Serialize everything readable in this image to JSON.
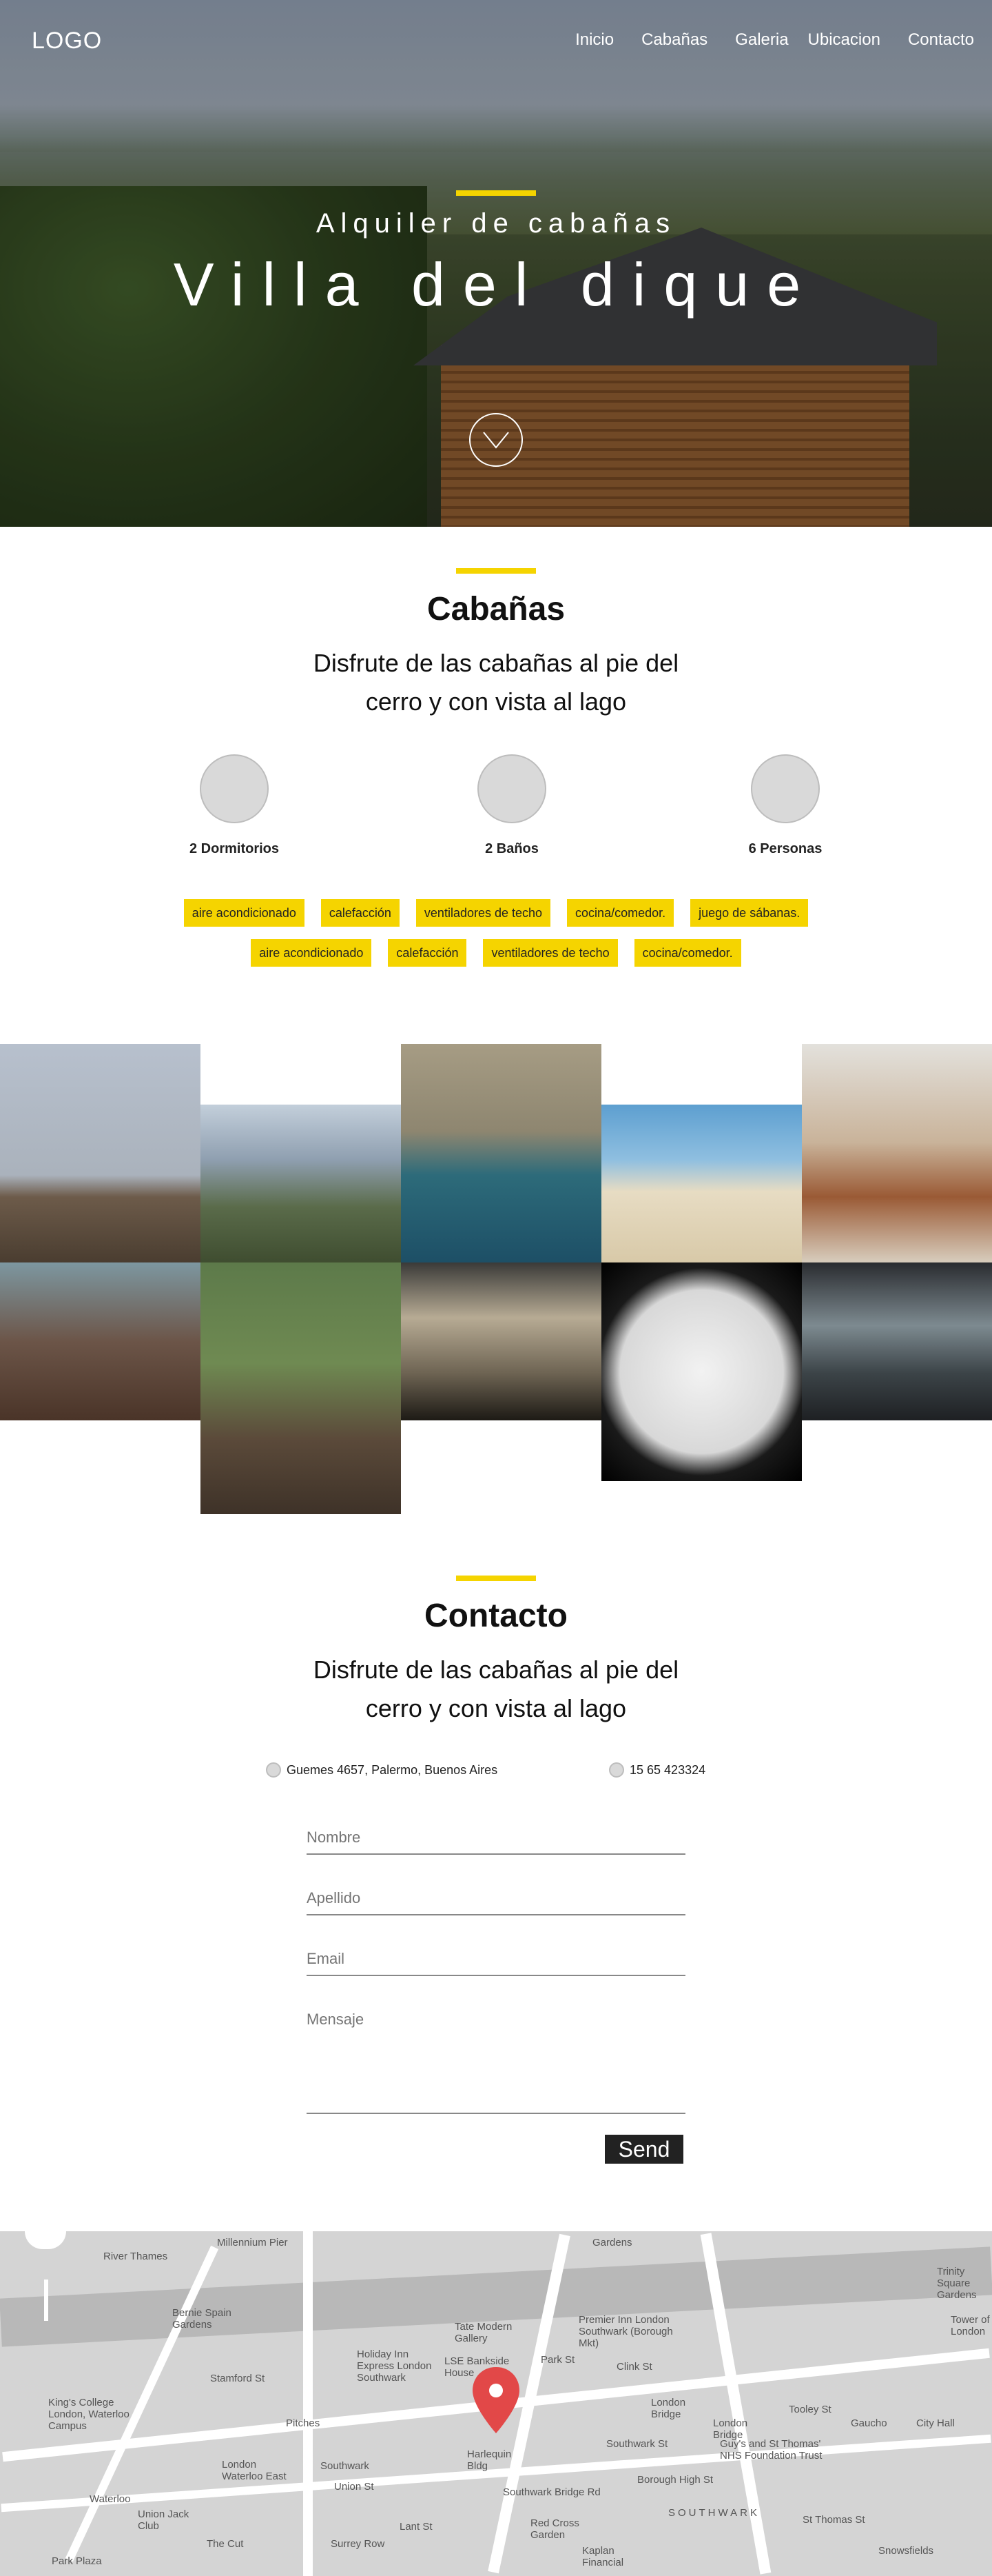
{
  "nav": {
    "logo": "LOGO",
    "links": [
      "Inicio",
      "Cabañas",
      "Galeria",
      "Ubicacion",
      "Contacto"
    ]
  },
  "hero": {
    "subtitle": "Alquiler de cabañas",
    "title": "Villa del dique"
  },
  "cabanas": {
    "title": "Cabañas",
    "description": "Disfrute de las cabañas al pie del cerro y con vista al lago",
    "features": [
      "2 Dormitorios",
      "2 Baños",
      "6 Personas"
    ],
    "tags_row1": [
      "aire acondicionado",
      "calefacción",
      "ventiladores de techo",
      "cocina/comedor.",
      "juego de sábanas."
    ],
    "tags_row2": [
      "aire acondicionado",
      "calefacción",
      "ventiladores de techo",
      "cocina/comedor."
    ]
  },
  "contacto": {
    "title": "Contacto",
    "description": "Disfrute de las cabañas al pie del cerro y con vista al lago",
    "address": "Guemes 4657, Palermo, Buenos Aires",
    "phone": "15 65 423324",
    "placeholders": {
      "nombre": "Nombre",
      "apellido": "Apellido",
      "email": "Email",
      "mensaje": "Mensaje"
    },
    "send_label": "Send"
  },
  "map": {
    "labels": [
      "River Thames",
      "Millennium Pier",
      "Gardens",
      "Bernie Spain Gardens",
      "Tate Modern Gallery",
      "Holiday Inn Express London Southwark",
      "LSE Bankside House",
      "Premier Inn London Southwark (Borough Mkt)",
      "King's College London, Waterloo Campus",
      "Pitches",
      "London Bridge",
      "London Bridge",
      "Gaucho",
      "City Hall",
      "Trinity Square Gardens",
      "Tower of London",
      "Harlequin Bldg",
      "London Waterloo East",
      "Southwark",
      "Waterloo",
      "Union Jack Club",
      "Union St",
      "Southwark St",
      "Guy's and St Thomas' NHS Foundation Trust",
      "SOUTHWARK",
      "Red Cross Garden",
      "Kaplan Financial",
      "Park Plaza",
      "Stamford St",
      "Tooley St",
      "Park St",
      "Clink St",
      "Borough High St",
      "The Cut",
      "Surrey Row",
      "Lant St",
      "Snowsfields",
      "St Thomas St",
      "Southwark Bridge Rd"
    ]
  },
  "colors": {
    "accent": "#f5d400",
    "dark": "#222222",
    "circle": "#d9d9d9"
  }
}
